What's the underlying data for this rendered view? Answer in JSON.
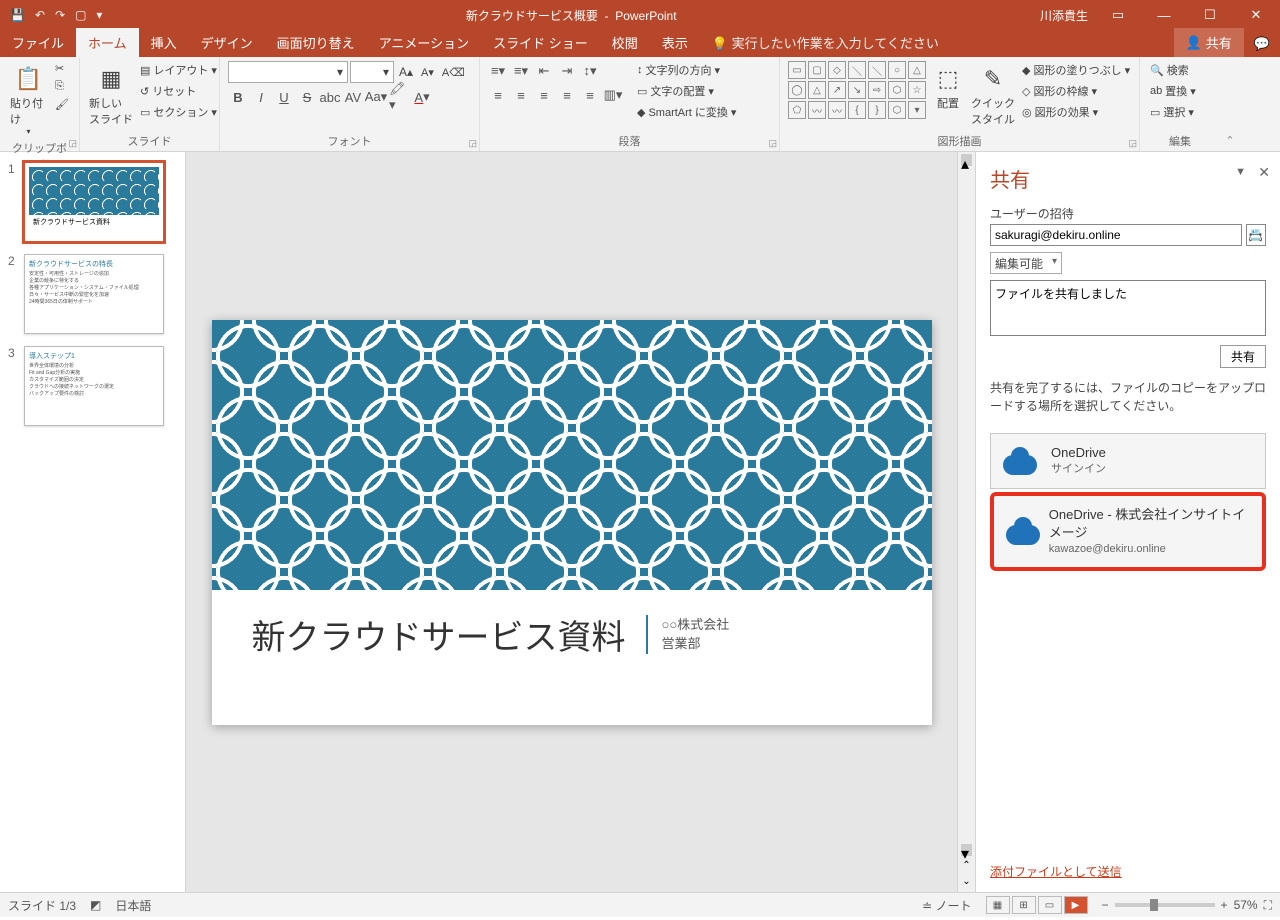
{
  "title": {
    "doc": "新クラウドサービス概要",
    "app": "PowerPoint",
    "user": "川添貴生"
  },
  "qat": [
    "💾",
    "↶",
    "↷",
    "▦",
    "▾"
  ],
  "tabs": {
    "file": "ファイル",
    "home": "ホーム",
    "insert": "挿入",
    "design": "デザイン",
    "transition": "画面切り替え",
    "anim": "アニメーション",
    "slideshow": "スライド ショー",
    "review": "校閲",
    "view": "表示",
    "tell": "実行したい作業を入力してください",
    "share": "共有"
  },
  "ribbon": {
    "clipboard": {
      "label": "クリップボード",
      "paste": "貼り付け"
    },
    "slides": {
      "label": "スライド",
      "new": "新しい\nスライド",
      "layout": "レイアウト",
      "reset": "リセット",
      "section": "セクション"
    },
    "font": {
      "label": "フォント"
    },
    "paragraph": {
      "label": "段落",
      "dir": "文字列の方向",
      "align": "文字の配置",
      "smart": "SmartArt に変換"
    },
    "drawing": {
      "label": "図形描画",
      "arrange": "配置",
      "quick": "クイック\nスタイル",
      "fill": "図形の塗りつぶし",
      "outline": "図形の枠線",
      "effects": "図形の効果"
    },
    "editing": {
      "label": "編集",
      "find": "検索",
      "replace": "置換",
      "select": "選択"
    }
  },
  "thumbs": [
    {
      "n": "1",
      "title": "新クラウドサービス資料",
      "pattern": true
    },
    {
      "n": "2",
      "title": "新クラウドサービスの特長",
      "lines": [
        "安定性・可用性・ストレージの追加",
        "企業の競争に特化する",
        "各種アプリケーション・システム・ファイル処理",
        "日々・サービス中断の緊密化を加速",
        "24時間365日の体制サポート"
      ]
    },
    {
      "n": "3",
      "title": "導入ステップ1",
      "lines": [
        "世界全体環境の分析",
        "Fit and Gap分析の実施",
        "カスタマイズ範囲の決定",
        "クラウドへの接続ネットワークの選定",
        "バックアップ要件の検討"
      ]
    }
  ],
  "slide": {
    "title": "新クラウドサービス資料",
    "sub1": "○○株式会社",
    "sub2": "営業部"
  },
  "sharepane": {
    "heading": "共有",
    "invite_label": "ユーザーの招待",
    "email": "sakuragi@dekiru.online",
    "perm": "編集可能",
    "msg": "ファイルを共有しました",
    "sharebtn": "共有",
    "help": "共有を完了するには、ファイルのコピーをアップロードする場所を選択してください。",
    "loc1": {
      "t1": "OneDrive",
      "t2": "サインイン"
    },
    "loc2": {
      "t1": "OneDrive - 株式会社インサイトイメージ",
      "t2": "kawazoe@dekiru.online"
    },
    "attach": "添付ファイルとして送信"
  },
  "status": {
    "slide": "スライド 1/3",
    "lang": "日本語",
    "notes": "ノート",
    "zoom": "57%"
  }
}
